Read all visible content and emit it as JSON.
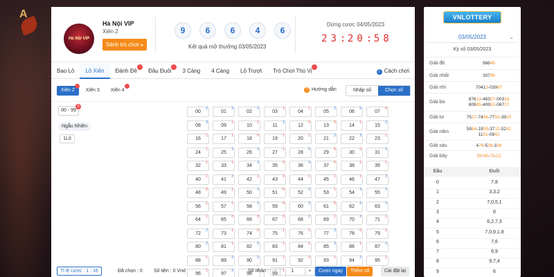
{
  "brand": {
    "bg_logo": "A"
  },
  "header": {
    "avatar_text": "Hà Nội VIP",
    "title": "Hà Nội VIP",
    "subtitle": "Xiên 2",
    "lobby_button": "Sảnh trò chơi",
    "result_balls": [
      "9",
      "6",
      "6",
      "4",
      "6"
    ],
    "result_caption": "Kết quả mở thưởng 03/05/2023",
    "cutoff_label": "Dừng cược 04/05/2023",
    "timer": [
      "2",
      "3",
      "2",
      "0",
      "5",
      "8"
    ]
  },
  "tabs": [
    {
      "label": "Bao Lô",
      "active": false,
      "badge": false
    },
    {
      "label": "Lô Xiên",
      "active": true,
      "badge": false
    },
    {
      "label": "Đánh Đề",
      "active": false,
      "badge": true
    },
    {
      "label": "Đầu Đuôi",
      "active": false,
      "badge": true
    },
    {
      "label": "3 Càng",
      "active": false,
      "badge": false
    },
    {
      "label": "4 Càng",
      "active": false,
      "badge": false
    },
    {
      "label": "Lô Trượt",
      "active": false,
      "badge": false
    },
    {
      "label": "Trò Chơi Thú Vị",
      "active": false,
      "badge": true
    }
  ],
  "how_to_play": "Cách chơi",
  "subtabs": [
    {
      "label": "Xiên 2",
      "active": true,
      "badge": true
    },
    {
      "label": "Xiên 3",
      "active": false,
      "badge": false
    },
    {
      "label": "Xiên 4",
      "active": false,
      "badge": true
    }
  ],
  "guide_label": "Hướng dẫn",
  "input_modes": [
    {
      "label": "Nhập số",
      "active": false
    },
    {
      "label": "Chọn số nhanh",
      "active": true
    }
  ],
  "left_panel": {
    "range_label": "00 - 99",
    "range_badge": "0",
    "random_label": "Ngẫu Nhiên",
    "one_lo": "1Lô"
  },
  "numbers": [
    {
      "n": "00",
      "s": "2",
      "c": "blue"
    },
    {
      "n": "01",
      "s": "3",
      "c": "blue"
    },
    {
      "n": "02",
      "s": "2",
      "c": "blue"
    },
    {
      "n": "03",
      "s": "1",
      "c": "red"
    },
    {
      "n": "04",
      "s": "1",
      "c": "red"
    },
    {
      "n": "05",
      "s": "2",
      "c": "blue"
    },
    {
      "n": "06",
      "s": "5",
      "c": "blue"
    },
    {
      "n": "07",
      "s": "0",
      "c": "red"
    },
    {
      "n": "08",
      "s": "3",
      "c": "blue"
    },
    {
      "n": "09",
      "s": "1",
      "c": "red"
    },
    {
      "n": "10",
      "s": "1",
      "c": "red"
    },
    {
      "n": "11",
      "s": "2",
      "c": "blue"
    },
    {
      "n": "12",
      "s": "0",
      "c": "red"
    },
    {
      "n": "13",
      "s": "0",
      "c": "red"
    },
    {
      "n": "14",
      "s": "1",
      "c": "red"
    },
    {
      "n": "15",
      "s": "2",
      "c": "blue"
    },
    {
      "n": "16",
      "s": "1",
      "c": "red"
    },
    {
      "n": "17",
      "s": "1",
      "c": "red"
    },
    {
      "n": "18",
      "s": "0",
      "c": "red"
    },
    {
      "n": "19",
      "s": "1",
      "c": "red"
    },
    {
      "n": "20",
      "s": "1",
      "c": "red"
    },
    {
      "n": "21",
      "s": "2",
      "c": "blue"
    },
    {
      "n": "22",
      "s": "3",
      "c": "blue"
    },
    {
      "n": "23",
      "s": "1",
      "c": "red"
    },
    {
      "n": "24",
      "s": "1",
      "c": "red"
    },
    {
      "n": "25",
      "s": "2",
      "c": "blue"
    },
    {
      "n": "26",
      "s": "3",
      "c": "blue"
    },
    {
      "n": "27",
      "s": "1",
      "c": "red"
    },
    {
      "n": "28",
      "s": "5",
      "c": "blue"
    },
    {
      "n": "29",
      "s": "0",
      "c": "red"
    },
    {
      "n": "30",
      "s": "0",
      "c": "red"
    },
    {
      "n": "31",
      "s": "2",
      "c": "blue"
    },
    {
      "n": "32",
      "s": "1",
      "c": "red"
    },
    {
      "n": "33",
      "s": "1",
      "c": "red"
    },
    {
      "n": "34",
      "s": "3",
      "c": "blue"
    },
    {
      "n": "35",
      "s": "0",
      "c": "red"
    },
    {
      "n": "36",
      "s": "3",
      "c": "blue"
    },
    {
      "n": "37",
      "s": "0",
      "c": "red"
    },
    {
      "n": "38",
      "s": "1",
      "c": "red"
    },
    {
      "n": "39",
      "s": "1",
      "c": "red"
    },
    {
      "n": "40",
      "s": "1",
      "c": "red"
    },
    {
      "n": "41",
      "s": "2",
      "c": "blue"
    },
    {
      "n": "42",
      "s": "1",
      "c": "red"
    },
    {
      "n": "43",
      "s": "0",
      "c": "red"
    },
    {
      "n": "44",
      "s": "1",
      "c": "red"
    },
    {
      "n": "45",
      "s": "1",
      "c": "red"
    },
    {
      "n": "46",
      "s": "1",
      "c": "red"
    },
    {
      "n": "47",
      "s": "2",
      "c": "blue"
    },
    {
      "n": "48",
      "s": "0",
      "c": "red"
    },
    {
      "n": "49",
      "s": "1",
      "c": "red"
    },
    {
      "n": "50",
      "s": "2",
      "c": "blue"
    },
    {
      "n": "51",
      "s": "0",
      "c": "red"
    },
    {
      "n": "52",
      "s": "2",
      "c": "blue"
    },
    {
      "n": "53",
      "s": "1",
      "c": "red"
    },
    {
      "n": "54",
      "s": "3",
      "c": "blue"
    },
    {
      "n": "55",
      "s": "2",
      "c": "blue"
    },
    {
      "n": "56",
      "s": "1",
      "c": "red"
    },
    {
      "n": "57",
      "s": "1",
      "c": "red"
    },
    {
      "n": "58",
      "s": "2",
      "c": "blue"
    },
    {
      "n": "59",
      "s": "0",
      "c": "red"
    },
    {
      "n": "60",
      "s": "3",
      "c": "blue"
    },
    {
      "n": "61",
      "s": "0",
      "c": "red"
    },
    {
      "n": "62",
      "s": "2",
      "c": "blue"
    },
    {
      "n": "63",
      "s": "2",
      "c": "blue"
    },
    {
      "n": "64",
      "s": "1",
      "c": "red"
    },
    {
      "n": "65",
      "s": "0",
      "c": "red"
    },
    {
      "n": "66",
      "s": "0",
      "c": "red"
    },
    {
      "n": "67",
      "s": "0",
      "c": "red"
    },
    {
      "n": "68",
      "s": "2",
      "c": "blue"
    },
    {
      "n": "69",
      "s": "1",
      "c": "red"
    },
    {
      "n": "70",
      "s": "2",
      "c": "blue"
    },
    {
      "n": "71",
      "s": "1",
      "c": "red"
    },
    {
      "n": "72",
      "s": "2",
      "c": "blue"
    },
    {
      "n": "73",
      "s": "1",
      "c": "red"
    },
    {
      "n": "74",
      "s": "0",
      "c": "red"
    },
    {
      "n": "75",
      "s": "1",
      "c": "red"
    },
    {
      "n": "76",
      "s": "1",
      "c": "red"
    },
    {
      "n": "77",
      "s": "3",
      "c": "blue"
    },
    {
      "n": "78",
      "s": "0",
      "c": "red"
    },
    {
      "n": "79",
      "s": "1",
      "c": "red"
    },
    {
      "n": "80",
      "s": "2",
      "c": "blue"
    },
    {
      "n": "81",
      "s": "1",
      "c": "red"
    },
    {
      "n": "82",
      "s": "2",
      "c": "blue"
    },
    {
      "n": "83",
      "s": "1",
      "c": "red"
    },
    {
      "n": "84",
      "s": "1",
      "c": "red"
    },
    {
      "n": "85",
      "s": "2",
      "c": "blue"
    },
    {
      "n": "86",
      "s": "1",
      "c": "red"
    },
    {
      "n": "87",
      "s": "2",
      "c": "blue"
    },
    {
      "n": "88",
      "s": "1",
      "c": "red"
    },
    {
      "n": "89",
      "s": "2",
      "c": "blue"
    },
    {
      "n": "90",
      "s": "2",
      "c": "blue"
    },
    {
      "n": "91",
      "s": "1",
      "c": "red"
    },
    {
      "n": "92",
      "s": "0",
      "c": "red"
    },
    {
      "n": "93",
      "s": "1",
      "c": "red"
    },
    {
      "n": "94",
      "s": "2",
      "c": "blue"
    },
    {
      "n": "95",
      "s": "1",
      "c": "red"
    },
    {
      "n": "96",
      "s": "1",
      "c": "red"
    },
    {
      "n": "97",
      "s": "2",
      "c": "blue"
    },
    {
      "n": "98",
      "s": "2",
      "c": "blue"
    },
    {
      "n": "99",
      "s": "1",
      "c": "red"
    }
  ],
  "footer": {
    "odds": "Tỉ lệ cược : 1 : 16",
    "selected": "Đã chọn : 0",
    "amount": "Số tiền : 0 Vnd",
    "multiplier_label": "Số nhân :",
    "multiplier_minus": "−",
    "multiplier_value": "1",
    "multiplier_plus": "+",
    "bet_now": "Cược ngay",
    "add_number": "Thêm số",
    "reset": "Cài đặt lại"
  },
  "colors": {
    "accent": "#2a6fc9",
    "orange": "#f48a17",
    "timer": "#e02a2a",
    "badge": "#f04d4d"
  },
  "side": {
    "logo": "VNLOTTERY",
    "date": "03/05/2023",
    "draw_label": "Kỳ số 03/05/2023",
    "prizes": [
      {
        "label": "Giải đb",
        "parts": [
          [
            "966",
            "n"
          ],
          [
            "46",
            "h"
          ]
        ]
      },
      {
        "label": "Giải nhất",
        "parts": [
          [
            "307",
            "n"
          ],
          [
            "96",
            "h"
          ]
        ]
      },
      {
        "label": "Giải nhì",
        "parts": [
          [
            "7041",
            "n"
          ],
          [
            "3",
            "h"
          ],
          [
            "-039",
            "n"
          ],
          [
            "67",
            "h"
          ]
        ]
      },
      {
        "label": "Giải ba",
        "parts": [
          [
            "876",
            "n"
          ],
          [
            "13",
            "h"
          ],
          [
            "-463",
            "n"
          ],
          [
            "57",
            "h"
          ],
          [
            "-003",
            "n"
          ],
          [
            "18",
            "h"
          ],
          [
            "\n809",
            "n"
          ],
          [
            "85",
            "h"
          ],
          [
            "-409",
            "n"
          ],
          [
            "51",
            "h"
          ],
          [
            "-067",
            "n"
          ],
          [
            "27",
            "h"
          ]
        ]
      },
      {
        "label": "Giải tư",
        "parts": [
          [
            "75",
            "n"
          ],
          [
            "27",
            "h"
          ],
          [
            "-74",
            "n"
          ],
          [
            "46",
            "h"
          ],
          [
            "-77",
            "n"
          ],
          [
            "50",
            "h"
          ],
          [
            "-39",
            "n"
          ],
          [
            "20",
            "h"
          ]
        ]
      },
      {
        "label": "Giải năm",
        "parts": [
          [
            "58",
            "n"
          ],
          [
            "84",
            "h"
          ],
          [
            "-19",
            "n"
          ],
          [
            "59",
            "h"
          ],
          [
            "-37",
            "n"
          ],
          [
            "12",
            "h"
          ],
          [
            "-52",
            "n"
          ],
          [
            "41",
            "h"
          ],
          [
            "\n11",
            "n"
          ],
          [
            "51",
            "h"
          ],
          [
            "-08",
            "n"
          ],
          [
            "42",
            "h"
          ]
        ]
      },
      {
        "label": "Giải sáu",
        "parts": [
          [
            "4",
            "n"
          ],
          [
            "76",
            "h"
          ],
          [
            "-5",
            "n"
          ],
          [
            "38",
            "h"
          ],
          [
            "-3",
            "n"
          ],
          [
            "38",
            "h"
          ]
        ]
      },
      {
        "label": "Giải bảy",
        "parts": [
          [
            "39",
            "h"
          ],
          [
            "-",
            "n"
          ],
          [
            "06",
            "h"
          ],
          [
            "-",
            "n"
          ],
          [
            "79",
            "h"
          ],
          [
            "-",
            "n"
          ],
          [
            "21",
            "h"
          ]
        ]
      }
    ],
    "dd_head": [
      "Đầu",
      "Đuôi"
    ],
    "dd_rows": [
      [
        "0",
        "7,8"
      ],
      [
        "1",
        "3,3,2"
      ],
      [
        "2",
        "7,0,5,1"
      ],
      [
        "3",
        "0"
      ],
      [
        "4",
        "6,2,7,3"
      ],
      [
        "5",
        "7,0,9,1,8"
      ],
      [
        "6",
        "7,6"
      ],
      [
        "7",
        "6,9"
      ],
      [
        "8",
        "9,7,4"
      ],
      [
        "9",
        "6"
      ]
    ]
  }
}
